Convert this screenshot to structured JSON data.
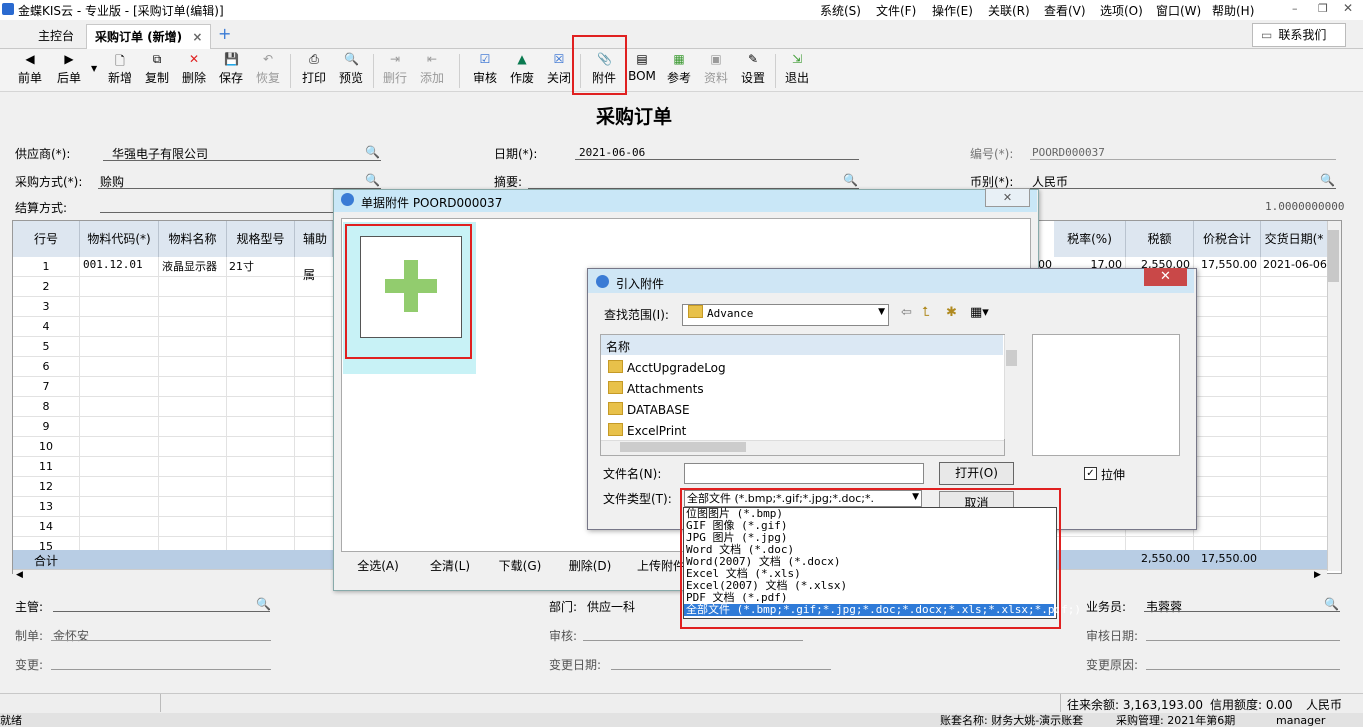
{
  "window": {
    "title": "金蝶KIS云 - 专业版 - [采购订单(编辑)]",
    "menus": [
      "系统(S)",
      "文件(F)",
      "操作(E)",
      "关联(R)",
      "查看(V)",
      "选项(O)",
      "窗口(W)",
      "帮助(H)"
    ]
  },
  "tabs": {
    "main": "主控台",
    "po": "采购订单 (新增)",
    "close": "×",
    "add": "+"
  },
  "chat_button": "联系我们",
  "toolbar": {
    "prev": "前单",
    "next": "后单",
    "new": "新增",
    "copy": "复制",
    "delete": "删除",
    "save": "保存",
    "restore": "恢复",
    "print": "打印",
    "preview": "预览",
    "delrow": "删行",
    "addrow": "添加",
    "audit": "审核",
    "void": "作废",
    "close": "关闭",
    "attach": "附件",
    "bom": "BOM",
    "reference": "参考",
    "material": "资料",
    "settings": "设置",
    "exit": "退出"
  },
  "form": {
    "title": "采购订单",
    "supplier_label": "供应商(*):",
    "supplier": "华强电子有限公司",
    "date_label": "日期(*):",
    "date": "2021-06-06",
    "number_label": "编号(*):",
    "number": "POORD000037",
    "purchase_method_label": "采购方式(*):",
    "purchase_method": "赊购",
    "summary_label": "摘要:",
    "currency_label": "币别(*):",
    "currency": "人民币",
    "settlement_label": "结算方式:",
    "exchange_rate": "1.0000000000"
  },
  "grid": {
    "headers_left": [
      "行号",
      "物料代码(*)",
      "物料名称",
      "规格型号",
      "辅助属"
    ],
    "headers_right": [
      "税率(%)",
      "税额",
      "价税合计",
      "交货日期(*"
    ],
    "row1": {
      "code": "001.12.01",
      "name": "液晶显示器",
      "spec": "21寸",
      "tax_rate": "17.00",
      "tax": "2,550.00",
      "total": "17,550.00",
      "delivery": "2021-06-06",
      "partial": "00"
    },
    "row_numbers": [
      "1",
      "2",
      "3",
      "4",
      "5",
      "6",
      "7",
      "8",
      "9",
      "10",
      "11",
      "12",
      "13",
      "14",
      "15"
    ],
    "sum_label": "合计",
    "sum_tax": "2,550.00",
    "sum_total": "17,550.00"
  },
  "bottom": {
    "manager_label": "主管:",
    "department_label": "部门:",
    "department": "供应一科",
    "salesman_label": "业务员:",
    "salesman": "韦蓉蓉",
    "maker_label": "制单:",
    "maker": "金怀安",
    "auditor_label": "审核:",
    "audit_date_label": "审核日期:",
    "changer_label": "变更:",
    "change_date_label": "变更日期:",
    "change_reason_label": "变更原因:"
  },
  "status": {
    "ready": "就绪",
    "balance": "往来余额: 3,163,193.00",
    "credit": "信用额度: 0.00",
    "currency": "人民币",
    "account": "账套名称: 财务大姚-演示账套",
    "period": "采购管理: 2021年第6期",
    "user": "manager"
  },
  "attach_dialog": {
    "title": "单据附件 POORD000037",
    "close": "✕",
    "buttons": [
      "全选(A)",
      "全清(L)",
      "下载(G)",
      "删除(D)",
      "上传附件"
    ]
  },
  "import_dialog": {
    "title": "引入附件",
    "close": "✕",
    "lookin_label": "查找范围(I):",
    "lookin_value": "Advance",
    "name_header": "名称",
    "folders": [
      "AcctUpgradeLog",
      "Attachments",
      "DATABASE",
      "ExcelPrint"
    ],
    "filename_label": "文件名(N):",
    "filename_value": "",
    "filetype_label": "文件类型(T):",
    "filetype_value": "全部文件 (*.bmp;*.gif;*.jpg;*.doc;*.",
    "open_button": "打开(O)",
    "cancel_button": "取消",
    "stretch_label": "拉伸",
    "stretch_checked": true,
    "filetype_options": [
      "位图图片 (*.bmp)",
      "GIF 图像 (*.gif)",
      "JPG 图片 (*.jpg)",
      "Word 文档 (*.doc)",
      "Word(2007) 文档 (*.docx)",
      "Excel 文档 (*.xls)",
      "Excel(2007) 文档 (*.xlsx)",
      "PDF 文档 (*.pdf)",
      "全部文件 (*.bmp;*.gif;*.jpg;*.doc;*.docx;*.xls;*.xlsx;*.pdf;)"
    ]
  },
  "colors": {
    "highlight": "#e02020",
    "selection": "#2f7bd8",
    "plus": "#92cc6e"
  }
}
